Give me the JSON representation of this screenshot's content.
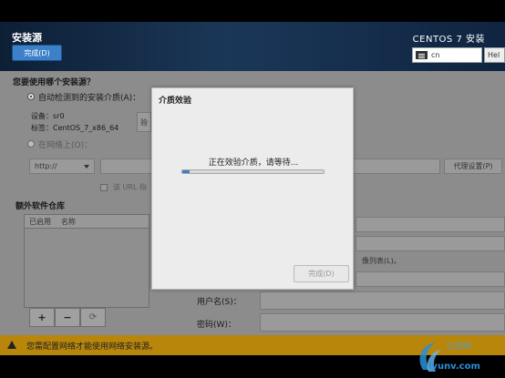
{
  "header": {
    "title": "安装源",
    "done_label": "完成(D)",
    "product": "CENTOS 7 安装",
    "keyboard_layout": "cn",
    "help_label": "Hel"
  },
  "source": {
    "question": "您要使用哪个安装源？",
    "auto_detect_label": "自动检测到的安装介质(A)：",
    "device_label": "设备：sr0",
    "label_label": "标签：CentOS_7_x86_64",
    "verify_partial": "验",
    "network_label": "在网络上(O)：",
    "protocol": "http://",
    "proxy_label": "代理设置(P)",
    "mirror_checkbox_label": "该 URL 指"
  },
  "repos": {
    "title": "额外软件仓库",
    "col_enabled": "已启用",
    "col_name": "名称",
    "add": "+",
    "remove": "−",
    "reset": "⟳",
    "mirror_hint": "像列表(L)。",
    "username_label": "用户名(S)：",
    "password_label": "密码(W)："
  },
  "warning": {
    "text": "您需配置网络才能使用网络安装源。"
  },
  "watermark": {
    "cn": "亿速网",
    "domain": "iyunv.com"
  },
  "dialog": {
    "title": "介质效验",
    "message": "正在效验介质，请等待...",
    "progress": 0.05,
    "done_label": "完成(D)"
  }
}
